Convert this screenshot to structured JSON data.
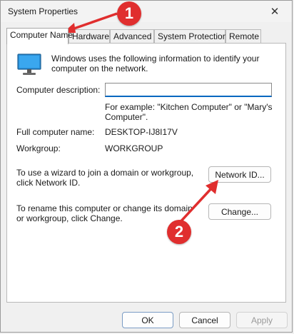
{
  "window": {
    "title": "System Properties",
    "close_glyph": "✕"
  },
  "tabs": [
    {
      "label": "Computer Name",
      "active": true
    },
    {
      "label": "Hardware"
    },
    {
      "label": "Advanced"
    },
    {
      "label": "System Protection"
    },
    {
      "label": "Remote"
    }
  ],
  "panel": {
    "intro": "Windows uses the following information to identify your computer on the network.",
    "description_label": "Computer description:",
    "description_value": "",
    "example": "For example: \"Kitchen Computer\" or \"Mary's Computer\".",
    "full_name_label": "Full computer name:",
    "full_name_value": "DESKTOP-IJ8I17V",
    "workgroup_label": "Workgroup:",
    "workgroup_value": "WORKGROUP",
    "wizard_text": "To use a wizard to join a domain or workgroup, click Network ID.",
    "network_id_button": "Network ID...",
    "rename_text": "To rename this computer or change its domain or workgroup, click Change.",
    "change_button": "Change..."
  },
  "footer": {
    "ok": "OK",
    "cancel": "Cancel",
    "apply": "Apply"
  },
  "annotations": {
    "badge_1": "1",
    "badge_2": "2",
    "color": "#e02e2e"
  },
  "icons": {
    "computer": "monitor-icon",
    "close": "close-icon"
  }
}
